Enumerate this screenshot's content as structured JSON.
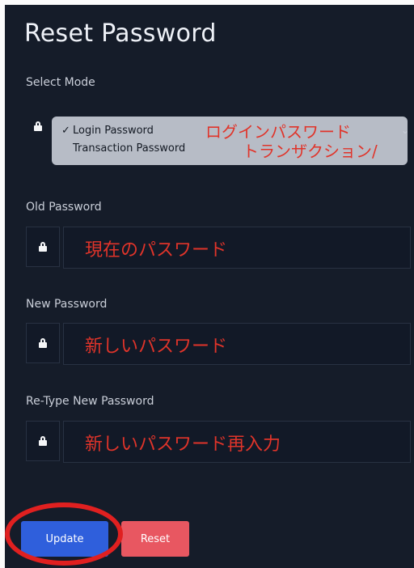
{
  "title": "Reset Password",
  "select_mode": {
    "label": "Select Mode",
    "options": [
      {
        "label": "Login Password",
        "selected": true,
        "annotation": "ログインパスワード"
      },
      {
        "label": "Transaction Password",
        "selected": false,
        "annotation": "トランザクション/"
      }
    ],
    "checkmark": "✓"
  },
  "old_password": {
    "label": "Old Password",
    "annotation": "現在のパスワード"
  },
  "new_password": {
    "label": "New Password",
    "annotation": "新しいパスワード"
  },
  "retype_password": {
    "label": "Re-Type New Password",
    "annotation": "新しいパスワード再入力"
  },
  "buttons": {
    "update": "Update",
    "reset": "Reset"
  },
  "colors": {
    "panel_bg": "#151c29",
    "update": "#2f5fdc",
    "reset": "#e85761",
    "annotation_red": "#e0342a"
  },
  "icons": {
    "lock": "lock-icon",
    "chevron": "chevron-down-icon"
  }
}
